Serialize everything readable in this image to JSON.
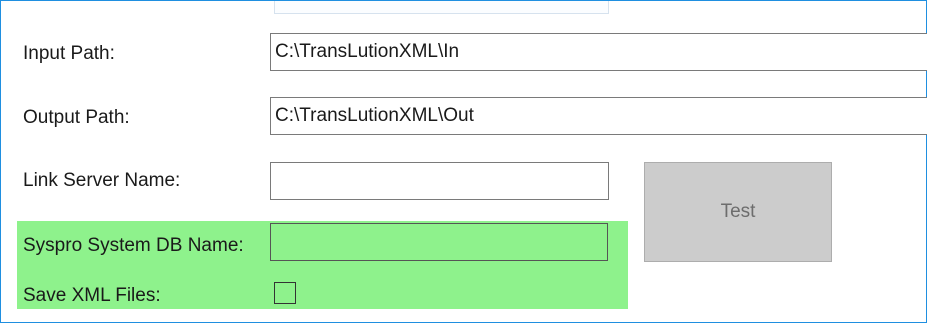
{
  "form": {
    "input_path": {
      "label": "Input Path:",
      "value": "C:\\TransLutionXML\\In"
    },
    "output_path": {
      "label": "Output Path:",
      "value": "C:\\TransLutionXML\\Out"
    },
    "link_server_name": {
      "label": "Link Server Name:",
      "value": ""
    },
    "syspro_system_db_name": {
      "label": "Syspro System DB Name:",
      "value": ""
    },
    "save_xml_files": {
      "label": "Save XML Files:",
      "checked": false
    },
    "test_button_label": "Test"
  },
  "colors": {
    "highlight": "#8ef28c",
    "frame_border": "#1f8fe0",
    "button_bg": "#cccccc"
  }
}
